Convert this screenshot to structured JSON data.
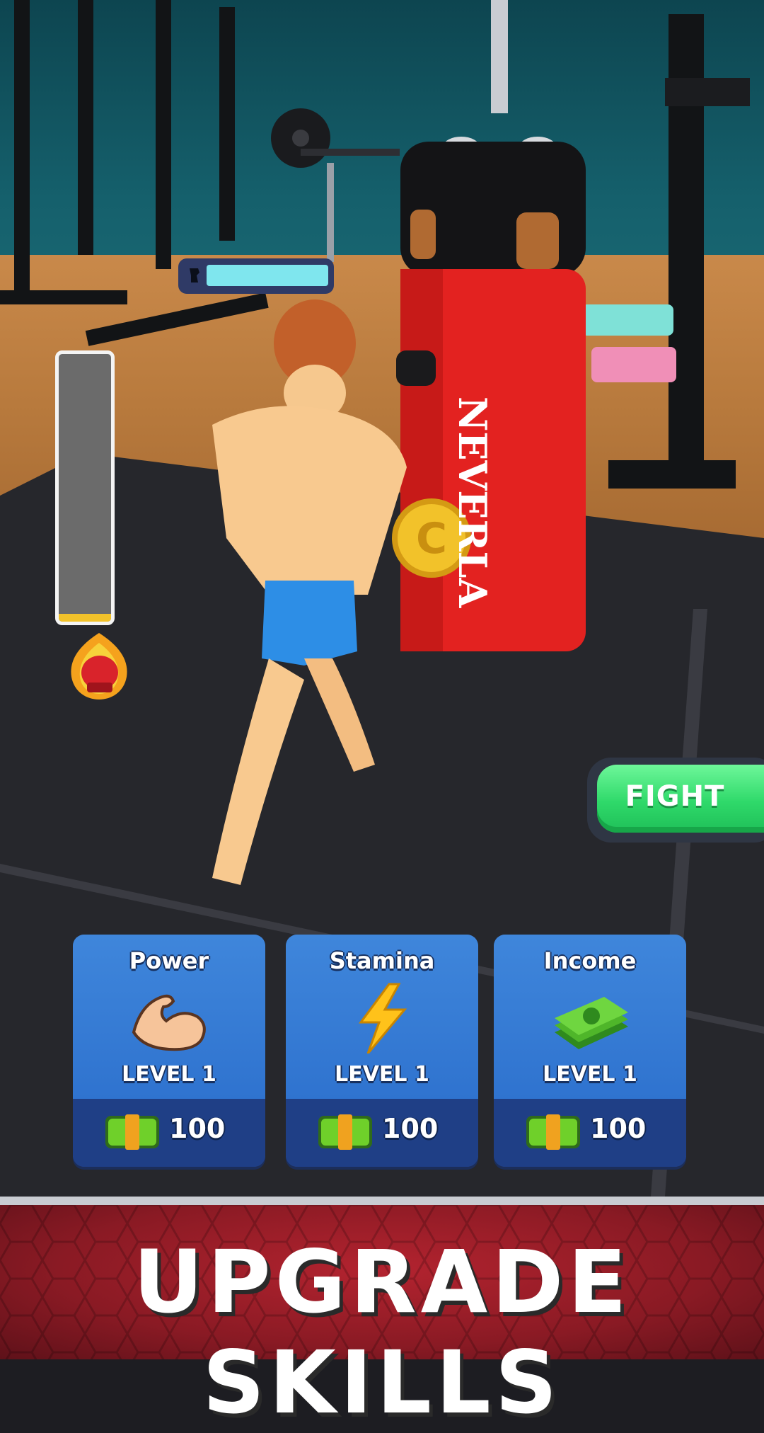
{
  "bag": {
    "brand": "NEVERLA"
  },
  "fight_button": {
    "label": "FIGHT"
  },
  "upgrades": [
    {
      "title": "Power",
      "icon": "flexed-bicep-icon",
      "level": "LEVEL 1",
      "cost": "100"
    },
    {
      "title": "Stamina",
      "icon": "lightning-bolt-icon",
      "level": "LEVEL 1",
      "cost": "100"
    },
    {
      "title": "Income",
      "icon": "cash-stack-icon",
      "level": "LEVEL 1",
      "cost": "100"
    }
  ],
  "coin": {
    "symbol": "C"
  },
  "stamina": {
    "fill_fraction": 0.95
  },
  "power_meter": {
    "fill_fraction": 0.03
  },
  "banner": {
    "title": "UPGRADE SKILLS"
  },
  "colors": {
    "fight_green": "#2fd96a",
    "card_blue": "#3f86db",
    "banner_red": "#b3232f",
    "bag_red": "#e32220",
    "coin_gold": "#f2c22a"
  }
}
